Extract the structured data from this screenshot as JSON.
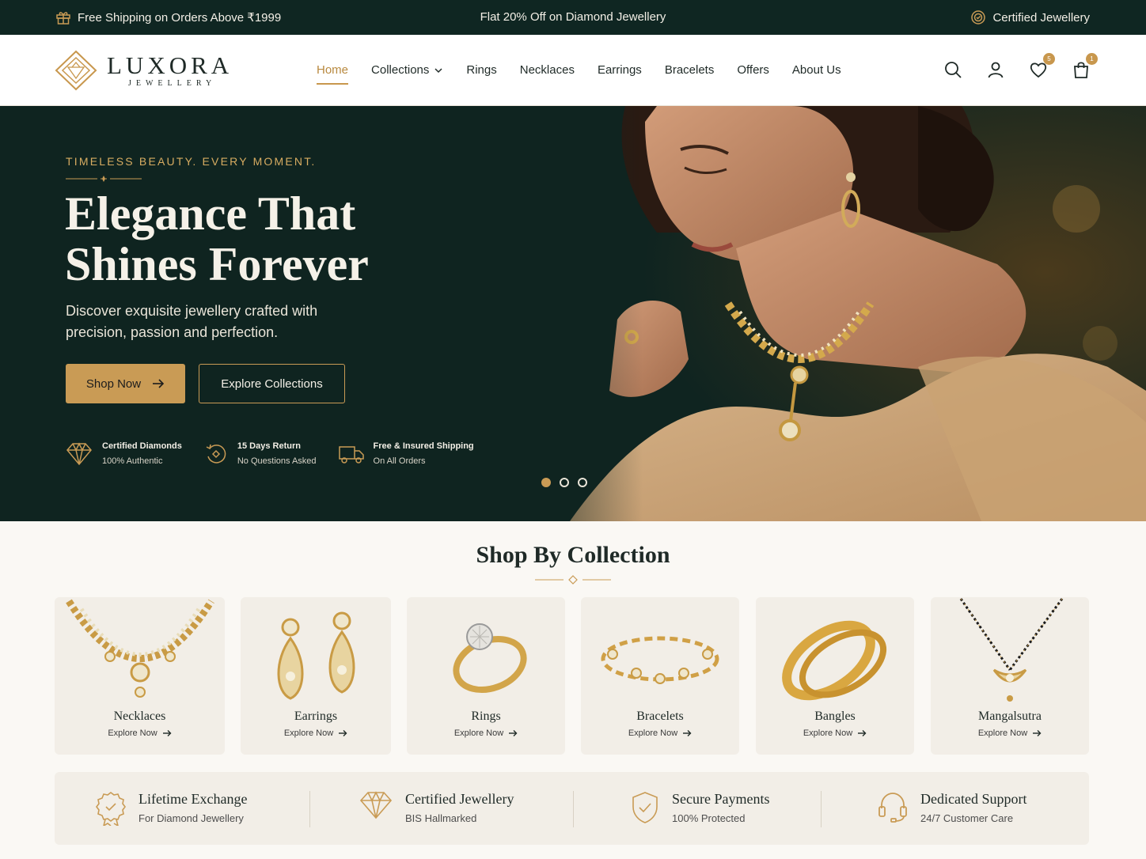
{
  "topbar": {
    "left_text": "Free Shipping on Orders Above ₹1999",
    "center_text": "Flat 20% Off on Diamond Jewellery",
    "right_text": "Certified Jewellery"
  },
  "brand": {
    "name": "LUXORA",
    "tagline": "JEWELLERY"
  },
  "nav": {
    "items": [
      {
        "label": "Home",
        "active": true
      },
      {
        "label": "Collections",
        "has_dropdown": true
      },
      {
        "label": "Rings"
      },
      {
        "label": "Necklaces"
      },
      {
        "label": "Earrings"
      },
      {
        "label": "Bracelets"
      },
      {
        "label": "Offers"
      },
      {
        "label": "About Us"
      }
    ]
  },
  "header_icons": {
    "search": "search-icon",
    "account": "user-icon",
    "wishlist": {
      "icon": "heart-icon",
      "count": "5"
    },
    "cart": {
      "icon": "shopping-bag-icon",
      "count": "1"
    }
  },
  "hero": {
    "eyebrow": "TIMELESS BEAUTY. EVERY MOMENT.",
    "title_line1": "Elegance That",
    "title_line2": "Shines Forever",
    "description": "Discover exquisite jewellery crafted with precision, passion and perfection.",
    "primary_button": "Shop Now",
    "secondary_button": "Explore Collections",
    "features": [
      {
        "icon": "diamond-icon",
        "title": "Certified Diamonds",
        "subtitle": "100% Authentic"
      },
      {
        "icon": "return-icon",
        "title": "15 Days Return",
        "subtitle": "No Questions Asked"
      },
      {
        "icon": "truck-icon",
        "title": "Free & Insured Shipping",
        "subtitle": "On All Orders"
      }
    ],
    "slides": {
      "count": 3,
      "active": 1
    }
  },
  "collection": {
    "title": "Shop By Collection",
    "link_label": "Explore Now",
    "items": [
      {
        "name": "Necklaces",
        "icon": "necklace-image"
      },
      {
        "name": "Earrings",
        "icon": "earrings-image"
      },
      {
        "name": "Rings",
        "icon": "ring-image"
      },
      {
        "name": "Bracelets",
        "icon": "bracelet-image"
      },
      {
        "name": "Bangles",
        "icon": "bangles-image"
      },
      {
        "name": "Mangalsutra",
        "icon": "mangalsutra-image"
      }
    ]
  },
  "trust": [
    {
      "icon": "award-icon",
      "title": "Lifetime Exchange",
      "subtitle": "For Diamond Jewellery"
    },
    {
      "icon": "diamond-icon",
      "title": "Certified Jewellery",
      "subtitle": "BIS Hallmarked"
    },
    {
      "icon": "shield-check-icon",
      "title": "Secure Payments",
      "subtitle": "100% Protected"
    },
    {
      "icon": "headset-icon",
      "title": "Dedicated Support",
      "subtitle": "24/7 Customer Care"
    }
  ],
  "colors": {
    "dark_green": "#0f2622",
    "gold": "#c99b55",
    "cream": "#faf8f4"
  }
}
